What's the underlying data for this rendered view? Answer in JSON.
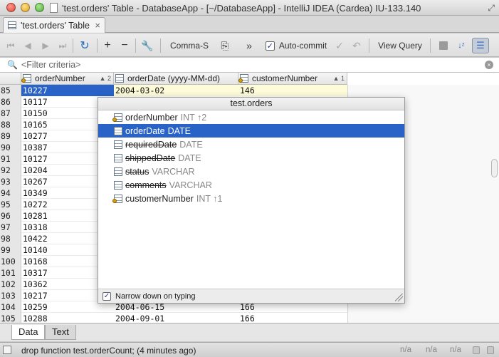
{
  "window": {
    "title": "'test.orders' Table - DatabaseApp - [~/DatabaseApp] - IntelliJ IDEA (Cardea) IU-133.140"
  },
  "editor_tab": {
    "label": "'test.orders' Table",
    "close": "×"
  },
  "toolbar": {
    "first_icon": "first-page-icon",
    "prev_icon": "previous-page-icon",
    "next_icon": "next-page-icon",
    "last_icon": "last-page-icon",
    "reload_icon": "reload-icon",
    "add_label": "+",
    "remove_label": "−",
    "settings_icon": "wrench-icon",
    "format_label": "Comma-S",
    "copy_icon": "copy-icon",
    "more_label": "»",
    "autocommit_label": "Auto-commit",
    "autocommit_checked": true,
    "autocommit_check": "✓",
    "commit_icon": "checkmark-icon",
    "rollback_icon": "undo-icon",
    "view_query_label": "View Query",
    "stop_icon": "stop-icon",
    "sort_icon": "sort-az-icon",
    "filter_icon": "filter-icon"
  },
  "filter": {
    "placeholder": "<Filter criteria>",
    "search_icon": "🔍",
    "clear_icon": "×"
  },
  "columns": [
    {
      "name": "orderNumber",
      "sort": "▲ 2",
      "key": true
    },
    {
      "name": "orderDate (yyyy-MM-dd)",
      "sort": "",
      "key": false
    },
    {
      "name": "customerNumber",
      "sort": "▲ 1",
      "key": true
    }
  ],
  "rows": [
    {
      "n": "85",
      "orderNumber": "10227",
      "orderDate": "2004-03-02",
      "customerNumber": "146"
    },
    {
      "n": "86",
      "orderNumber": "10117",
      "orderDate": "",
      "customerNumber": ""
    },
    {
      "n": "87",
      "orderNumber": "10150",
      "orderDate": "",
      "customerNumber": ""
    },
    {
      "n": "88",
      "orderNumber": "10165",
      "orderDate": "",
      "customerNumber": ""
    },
    {
      "n": "89",
      "orderNumber": "10277",
      "orderDate": "",
      "customerNumber": ""
    },
    {
      "n": "90",
      "orderNumber": "10387",
      "orderDate": "",
      "customerNumber": ""
    },
    {
      "n": "91",
      "orderNumber": "10127",
      "orderDate": "",
      "customerNumber": ""
    },
    {
      "n": "92",
      "orderNumber": "10204",
      "orderDate": "",
      "customerNumber": ""
    },
    {
      "n": "93",
      "orderNumber": "10267",
      "orderDate": "",
      "customerNumber": ""
    },
    {
      "n": "94",
      "orderNumber": "10349",
      "orderDate": "",
      "customerNumber": ""
    },
    {
      "n": "95",
      "orderNumber": "10272",
      "orderDate": "",
      "customerNumber": ""
    },
    {
      "n": "96",
      "orderNumber": "10281",
      "orderDate": "",
      "customerNumber": ""
    },
    {
      "n": "97",
      "orderNumber": "10318",
      "orderDate": "",
      "customerNumber": ""
    },
    {
      "n": "98",
      "orderNumber": "10422",
      "orderDate": "",
      "customerNumber": ""
    },
    {
      "n": "99",
      "orderNumber": "10140",
      "orderDate": "",
      "customerNumber": ""
    },
    {
      "n": "100",
      "orderNumber": "10168",
      "orderDate": "",
      "customerNumber": ""
    },
    {
      "n": "101",
      "orderNumber": "10317",
      "orderDate": "",
      "customerNumber": ""
    },
    {
      "n": "102",
      "orderNumber": "10362",
      "orderDate": "",
      "customerNumber": ""
    },
    {
      "n": "103",
      "orderNumber": "10217",
      "orderDate": "",
      "customerNumber": ""
    },
    {
      "n": "104",
      "orderNumber": "10259",
      "orderDate": "2004-06-15",
      "customerNumber": "166"
    },
    {
      "n": "105",
      "orderNumber": "10288",
      "orderDate": "2004-09-01",
      "customerNumber": "166"
    }
  ],
  "popup": {
    "title": "test.orders",
    "items": [
      {
        "name": "orderNumber",
        "type": "INT ↑2",
        "key": true,
        "struck": false,
        "selected": false
      },
      {
        "name": "orderDate",
        "type": "DATE",
        "key": false,
        "struck": false,
        "selected": true
      },
      {
        "name": "requiredDate",
        "type": "DATE",
        "key": false,
        "struck": true,
        "selected": false
      },
      {
        "name": "shippedDate",
        "type": "DATE",
        "key": false,
        "struck": true,
        "selected": false
      },
      {
        "name": "status",
        "type": "VARCHAR",
        "key": false,
        "struck": true,
        "selected": false
      },
      {
        "name": "comments",
        "type": "VARCHAR",
        "key": false,
        "struck": true,
        "selected": false
      },
      {
        "name": "customerNumber",
        "type": "INT ↑1",
        "key": true,
        "struck": false,
        "selected": false
      }
    ],
    "footer_check": "✓",
    "footer_label": "Narrow down on typing"
  },
  "bottom_tabs": [
    {
      "label": "Data",
      "active": true
    },
    {
      "label": "Text",
      "active": false
    }
  ],
  "status": {
    "message": "drop function test.orderCount; (4 minutes ago)",
    "na1": "n/a",
    "na2": "n/a",
    "na3": "n/a"
  },
  "colors": {
    "selection": "#2a63c8",
    "current_row": "#fdfbd8"
  }
}
